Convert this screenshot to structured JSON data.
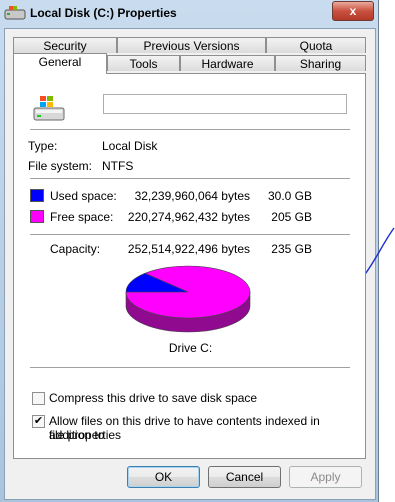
{
  "window": {
    "title": "Local Disk (C:) Properties",
    "close_glyph": "x"
  },
  "tabs_back": [
    "Security",
    "Previous Versions",
    "Quota"
  ],
  "tabs_front": [
    "General",
    "Tools",
    "Hardware",
    "Sharing"
  ],
  "active_tab": "General",
  "general": {
    "name_value": "",
    "type_label": "Type:",
    "type_value": "Local Disk",
    "fs_label": "File system:",
    "fs_value": "NTFS",
    "used": {
      "label": "Used space:",
      "bytes": "32,239,960,064 bytes",
      "size": "30.0 GB",
      "color": "#0000ff"
    },
    "free": {
      "label": "Free space:",
      "bytes": "220,274,962,432 bytes",
      "size": "205 GB",
      "color": "#ff00ff"
    },
    "capacity": {
      "label": "Capacity:",
      "bytes": "252,514,922,496 bytes",
      "size": "235 GB"
    },
    "drive_label": "Drive C:",
    "used_fraction": 0.1277,
    "compress": {
      "label": "Compress this drive to save disk space",
      "checked": false
    },
    "index": {
      "label_line1": "Allow files on this drive to have contents indexed in addition to",
      "label_line2": "file properties",
      "checked": true
    }
  },
  "buttons": {
    "ok": "OK",
    "cancel": "Cancel",
    "apply": "Apply"
  },
  "icons": [
    "drive-icon",
    "windows-logo-icon",
    "checkmark-icon",
    "pen-arrow-annotation"
  ]
}
